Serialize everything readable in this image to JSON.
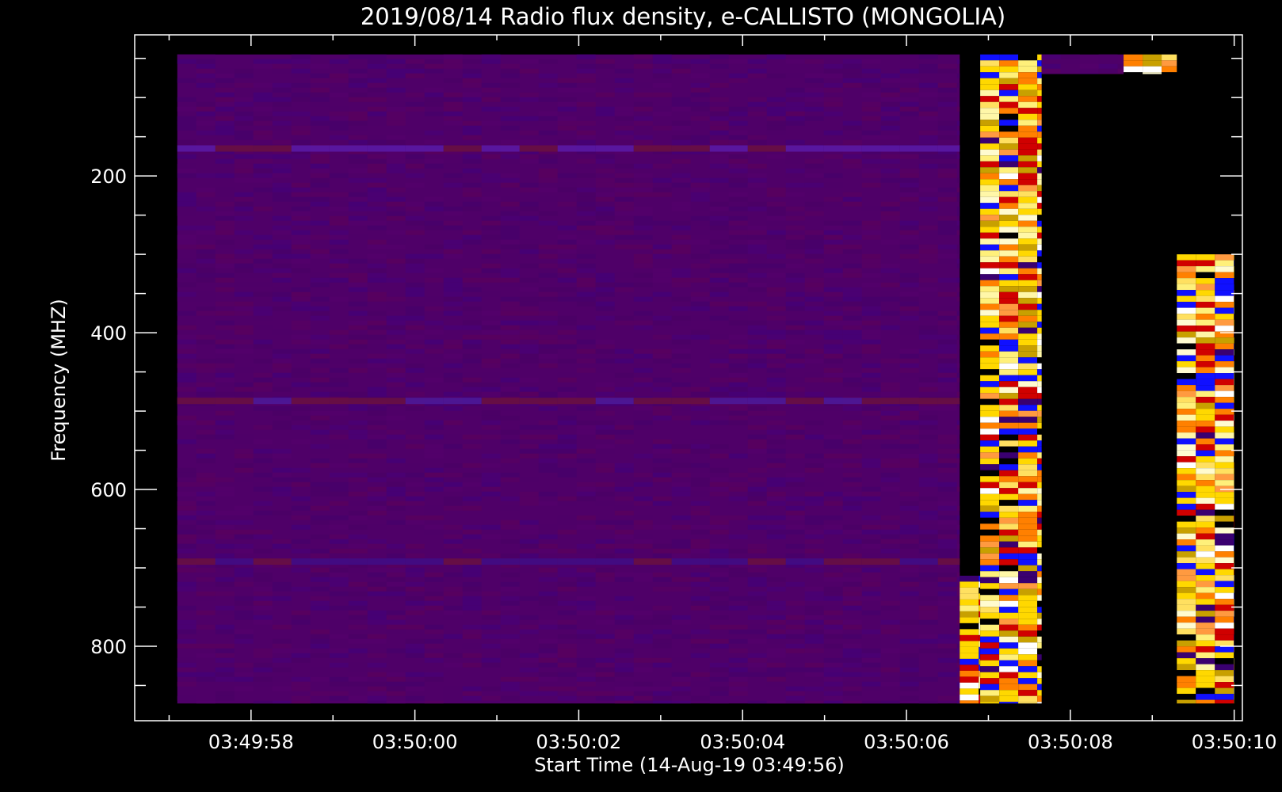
{
  "chart_data": {
    "type": "heatmap",
    "title": "2019/08/14  Radio flux density, e-CALLISTO (MONGOLIA)",
    "xlabel": "Start Time (14-Aug-19 03:49:56)",
    "ylabel": "Frequency (MHZ)",
    "x_unit": "seconds after 03:49:56",
    "xlim": [
      0.58,
      14.1
    ],
    "ylim": [
      895,
      20
    ],
    "y_reversed": true,
    "x_ticks": [
      {
        "value": 2,
        "label": "03:49:58"
      },
      {
        "value": 4,
        "label": "03:50:00"
      },
      {
        "value": 6,
        "label": "03:50:02"
      },
      {
        "value": 8,
        "label": "03:50:04"
      },
      {
        "value": 10,
        "label": "03:50:06"
      },
      {
        "value": 12,
        "label": "03:50:08"
      },
      {
        "value": 14,
        "label": "03:50:10"
      }
    ],
    "y_ticks": [
      {
        "value": 200,
        "label": "200"
      },
      {
        "value": 400,
        "label": "400"
      },
      {
        "value": 600,
        "label": "600"
      },
      {
        "value": 800,
        "label": "800"
      }
    ],
    "colormap": [
      "#000000",
      "#3a0070",
      "#5a006a",
      "#1010ff",
      "#d00000",
      "#ff8000",
      "#ffd800",
      "#ffffff"
    ],
    "background_level": "low (dark purple)",
    "regions": [
      {
        "t_start": 1.1,
        "t_end": 10.65,
        "f_min": 45,
        "f_max": 873,
        "level": "low"
      },
      {
        "t_start": 10.65,
        "t_end": 10.9,
        "f_min": 710,
        "f_max": 873,
        "level": "saturated"
      },
      {
        "t_start": 10.9,
        "t_end": 11.65,
        "f_min": 45,
        "f_max": 873,
        "level": "saturated"
      },
      {
        "t_start": 11.65,
        "t_end": 12.65,
        "f_min": 45,
        "f_max": 70,
        "level": "low"
      },
      {
        "t_start": 12.65,
        "t_end": 13.3,
        "f_min": 45,
        "f_max": 70,
        "level": "saturated"
      },
      {
        "t_start": 13.3,
        "t_end": 14.0,
        "f_min": 300,
        "f_max": 873,
        "level": "saturated"
      }
    ]
  }
}
